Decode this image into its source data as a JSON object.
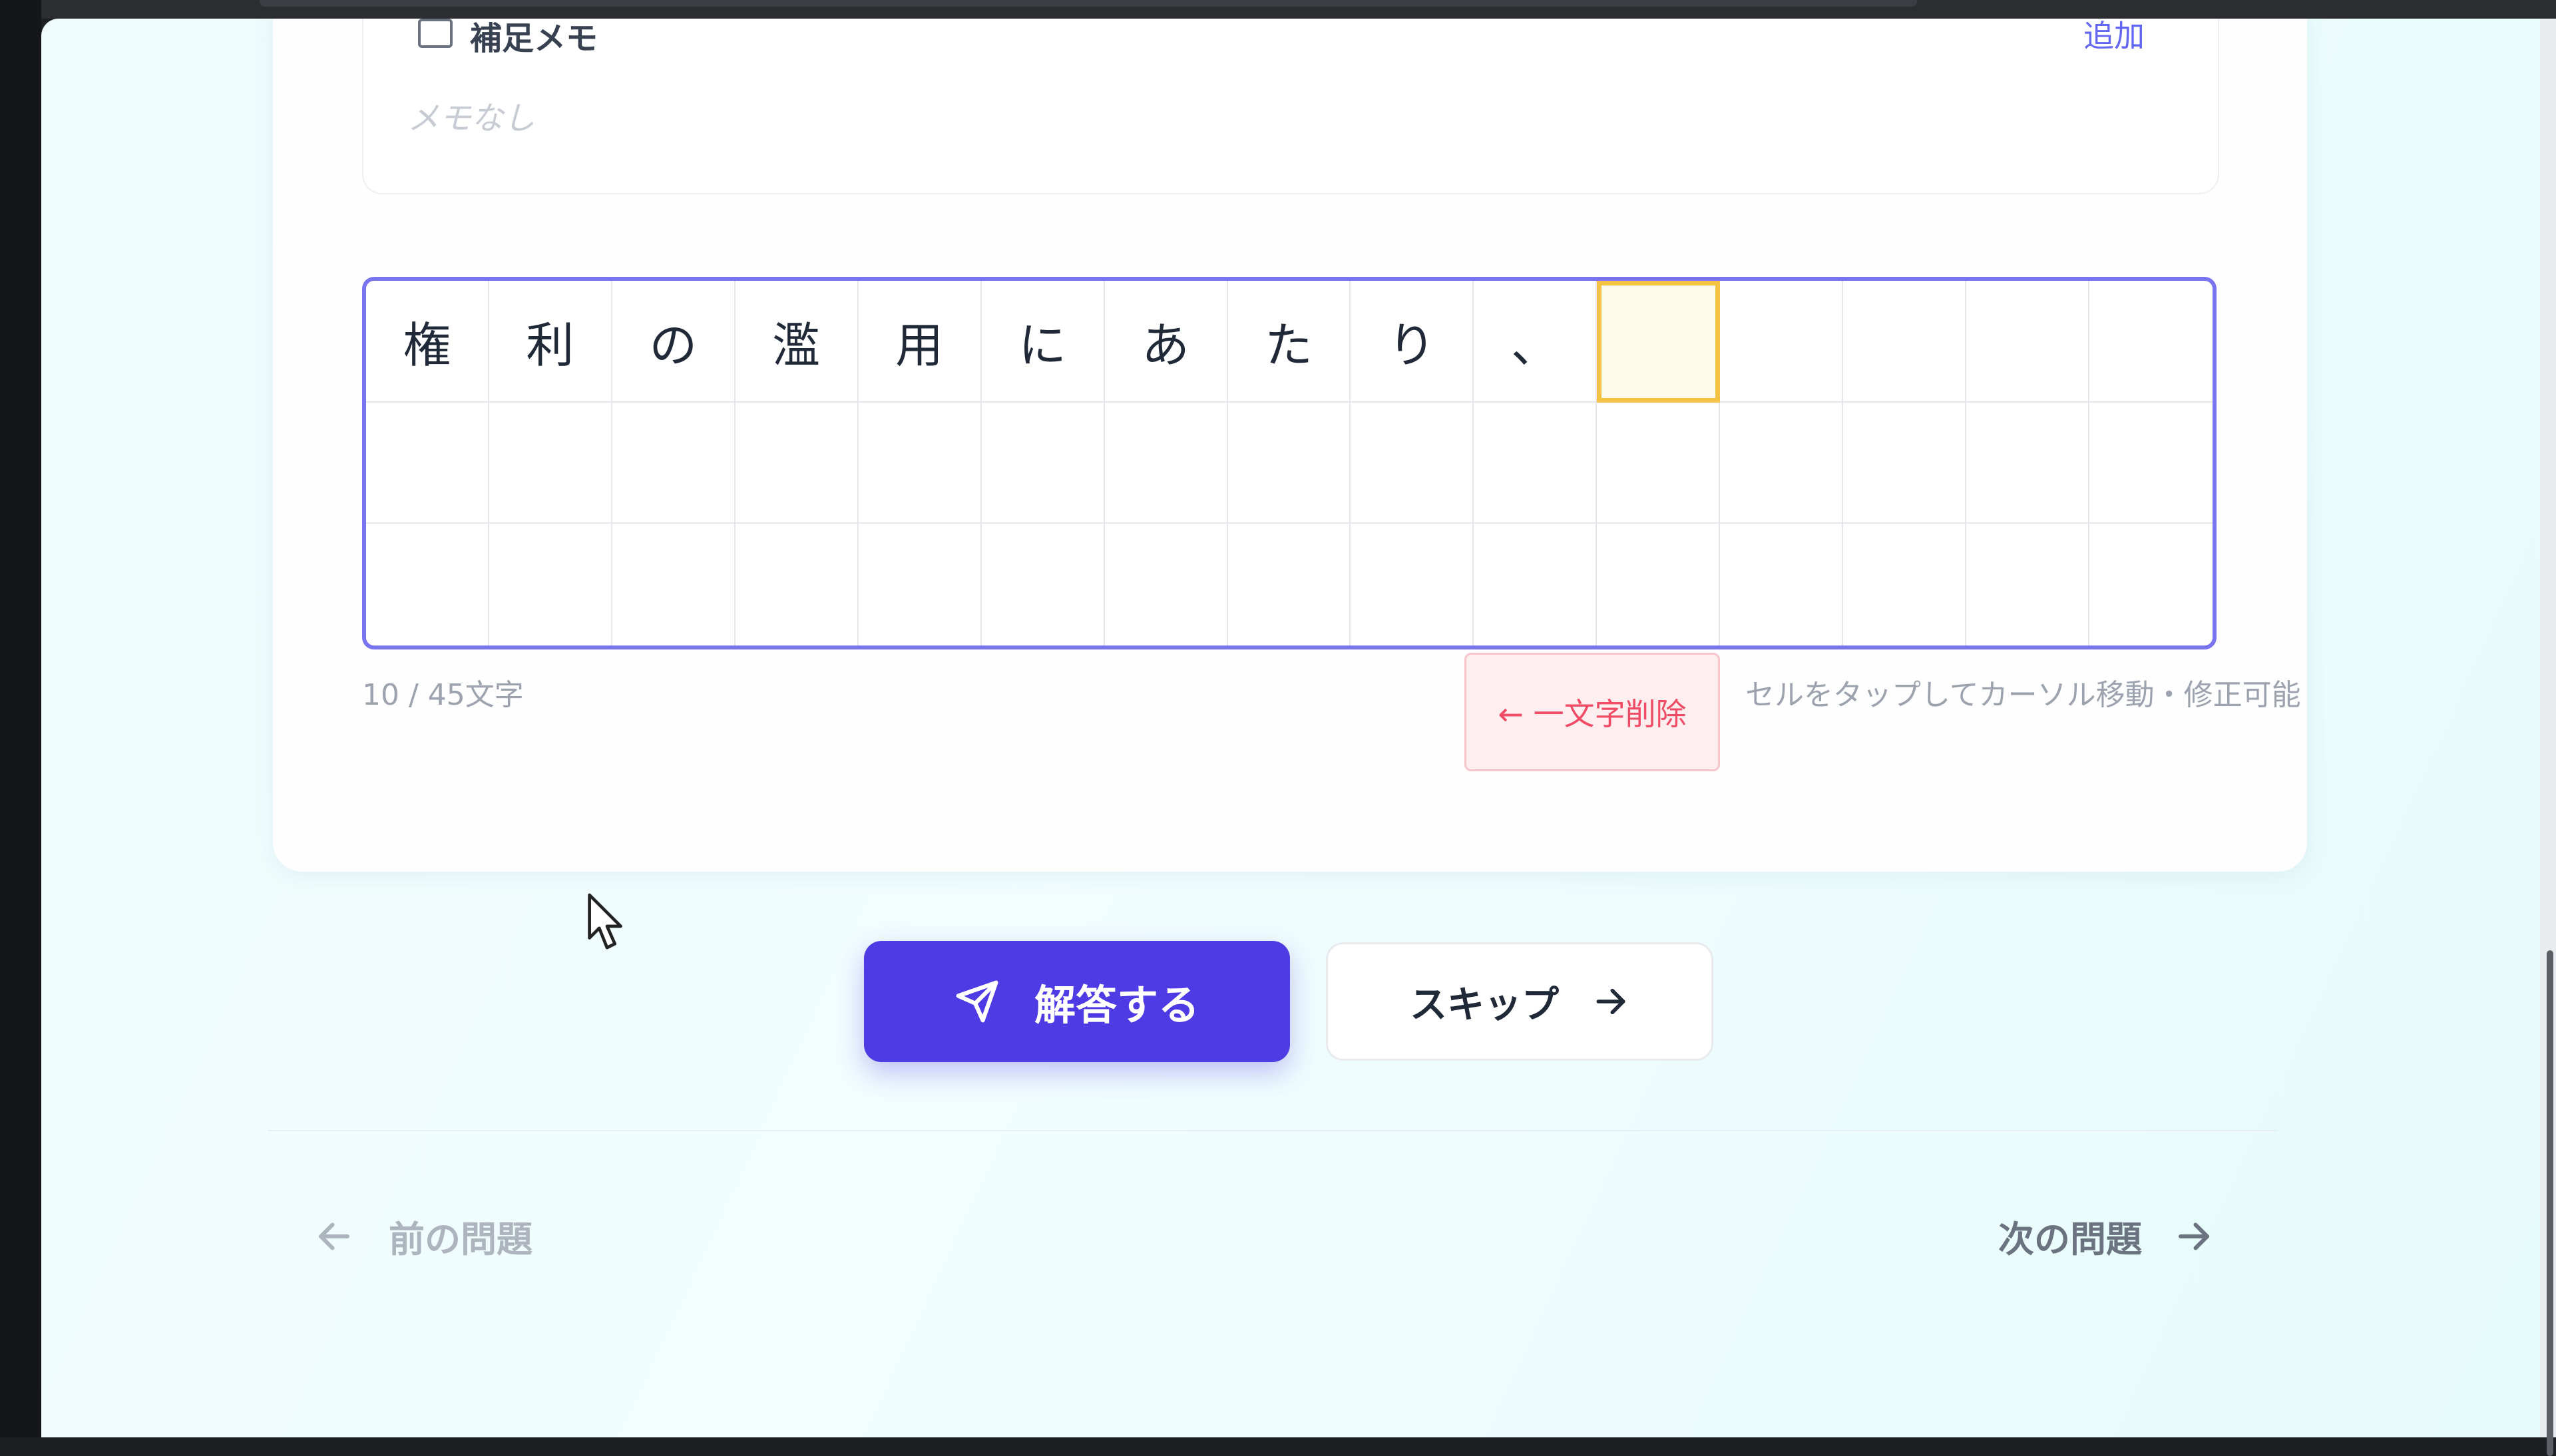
{
  "memo": {
    "title": "補足メモ",
    "add_label": "追加",
    "empty_text": "メモなし"
  },
  "answer_grid": {
    "columns": 15,
    "rows": 3,
    "cells": [
      "権",
      "利",
      "の",
      "濫",
      "用",
      "に",
      "あ",
      "た",
      "り",
      "、",
      "",
      "",
      "",
      "",
      "",
      "",
      "",
      "",
      "",
      "",
      "",
      "",
      "",
      "",
      "",
      "",
      "",
      "",
      "",
      "",
      "",
      "",
      "",
      "",
      "",
      "",
      "",
      "",
      "",
      "",
      "",
      "",
      "",
      "",
      ""
    ],
    "active_index": 10
  },
  "editor": {
    "char_count": "10 / 45文字",
    "delete_label": "← 一文字削除",
    "hint": "セルをタップしてカーソル移動・修正可能"
  },
  "actions": {
    "submit_label": "解答する",
    "skip_label": "スキップ"
  },
  "navigation": {
    "prev_label": "前の問題",
    "next_label": "次の問題"
  },
  "colors": {
    "primary": "#4f3be3",
    "grid_border": "#7b74f0",
    "active_cell": "#f5c343",
    "delete_text": "#ef4b64"
  },
  "icons": {
    "memo_checkbox": "checkbox-icon",
    "submit": "paper-plane-icon",
    "skip": "arrow-right-icon",
    "prev": "arrow-left-icon",
    "next": "arrow-right-icon",
    "cursor": "mouse-pointer-icon"
  }
}
